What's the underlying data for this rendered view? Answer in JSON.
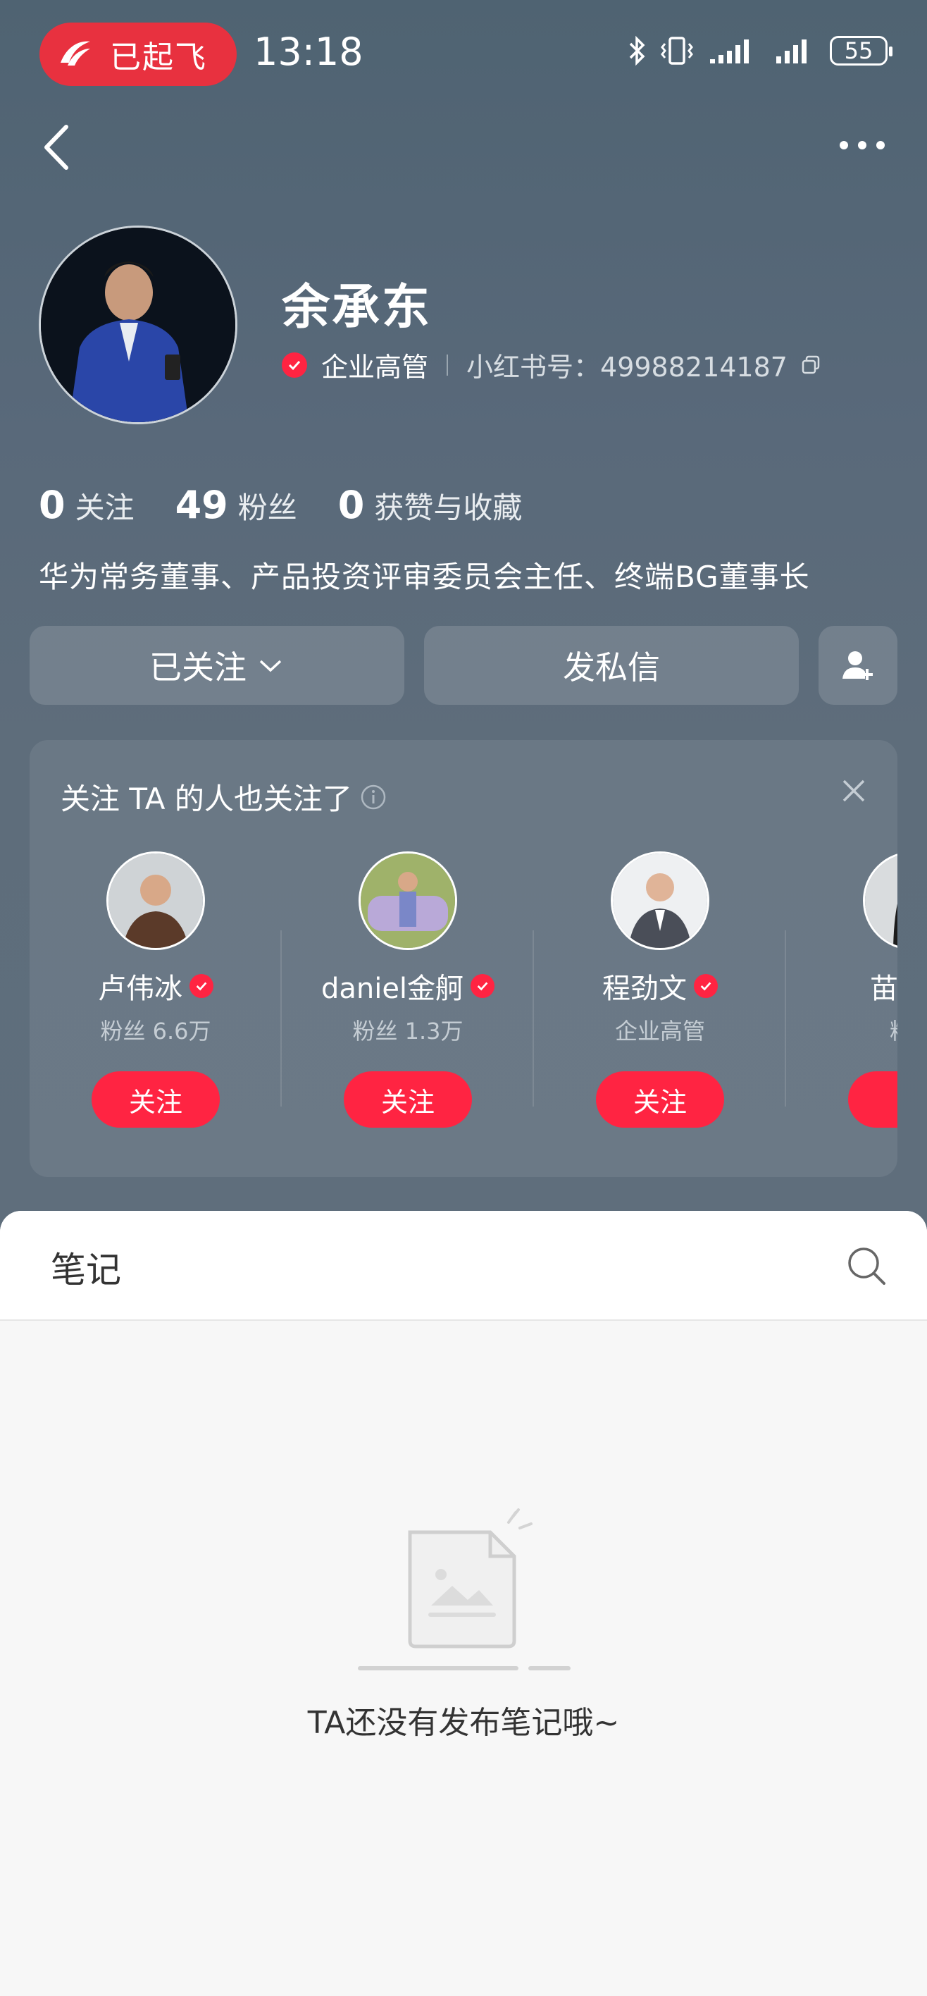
{
  "status_bar": {
    "flight_status": "已起飞",
    "time": "13:18",
    "battery": "55"
  },
  "profile": {
    "name": "余承东",
    "role": "企业高管",
    "id_label": "小红书号：49988214187",
    "stats": [
      {
        "value": "0",
        "label": "关注"
      },
      {
        "value": "49",
        "label": "粉丝"
      },
      {
        "value": "0",
        "label": "获赞与收藏"
      }
    ],
    "bio": "华为常务董事、产品投资评审委员会主任、终端BG董事长"
  },
  "actions": {
    "following_label": "已关注",
    "message_label": "发私信"
  },
  "recommend": {
    "title": "关注 TA 的人也关注了",
    "users": [
      {
        "name": "卢伟冰",
        "subtitle": "粉丝 6.6万",
        "button": "关注"
      },
      {
        "name": "daniel金舸",
        "subtitle": "粉丝 1.3万",
        "button": "关注"
      },
      {
        "name": "程劲文",
        "subtitle": "企业高管",
        "button": "关注"
      },
      {
        "name": "苗苗的",
        "subtitle": "粉丝",
        "button": "关"
      }
    ]
  },
  "notes": {
    "tab_label": "笔记",
    "empty_text": "TA还没有发布笔记哦~"
  },
  "colors": {
    "accent": "#ff2442",
    "flight_pill": "#e8313f",
    "hero_bg": "#5a6a78"
  }
}
